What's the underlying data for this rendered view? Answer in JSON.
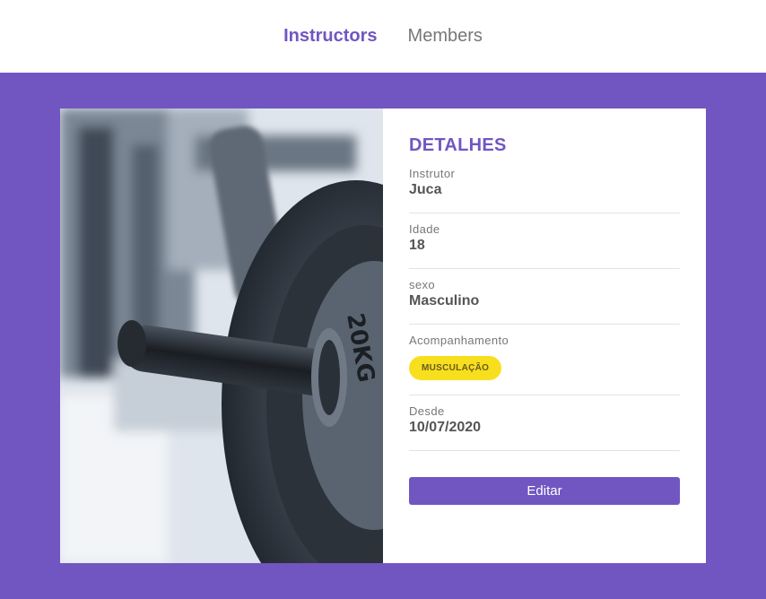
{
  "nav": {
    "instructors_label": "Instructors",
    "members_label": "Members"
  },
  "details": {
    "title": "DETALHES",
    "instructor_label": "Instrutor",
    "instructor_value": "Juca",
    "age_label": "Idade",
    "age_value": "18",
    "sex_label": "sexo",
    "sex_value": "Masculino",
    "services_label": "Acompanhamento",
    "services": [
      "MUSCULAÇÃO"
    ],
    "since_label": "Desde",
    "since_value": "10/07/2020",
    "edit_label": "Editar"
  },
  "colors": {
    "accent": "#7156c2",
    "badge": "#f7df1e"
  }
}
